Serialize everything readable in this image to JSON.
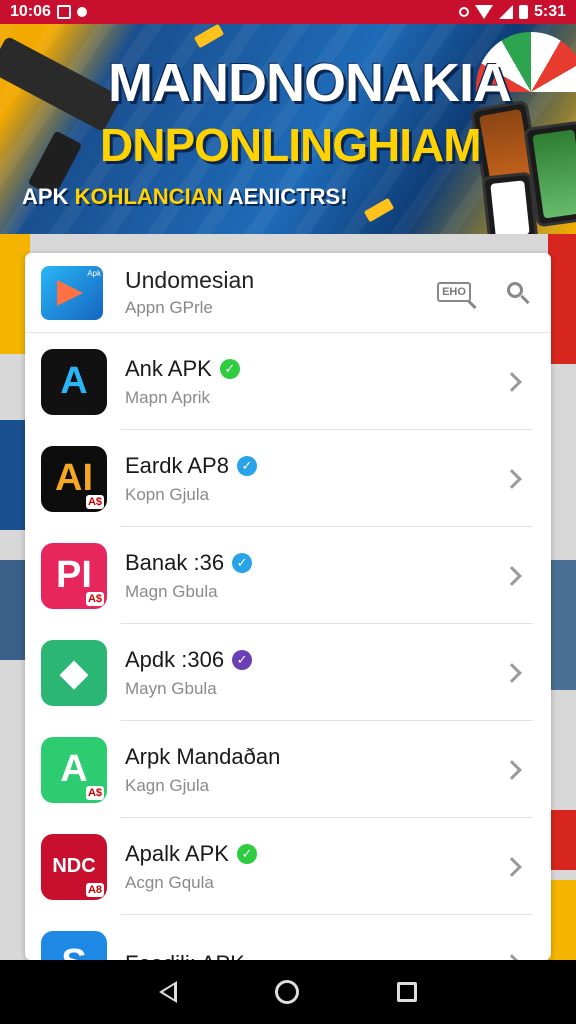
{
  "status_bar": {
    "time_left": "10:06",
    "time_right": "5:31"
  },
  "banner": {
    "title_line1": "MANDNONAKIA",
    "title_line2": "DNPONLINGHIAM",
    "subtitle_prefix": "APK",
    "subtitle_accent": "KOHLANCIAN",
    "subtitle_suffix": "AENICTRS!"
  },
  "header": {
    "title": "Undomesian",
    "subtitle": "Appn GPrle",
    "badge_text": "EHO",
    "logo_tag": "Apk"
  },
  "apps": [
    {
      "title": "Ank APK",
      "subtitle": "Mapn Aprik",
      "verified_color": "#2ecc40",
      "verified_glyph": "✓",
      "icon_bg": "#111111",
      "icon_fg": "#29b6f6",
      "icon_glyph": "A",
      "icon_mini": ""
    },
    {
      "title": "Eardk AP8",
      "subtitle": "Kopn Gjula",
      "verified_color": "#29a3e8",
      "verified_glyph": "✓",
      "icon_bg": "#0d0d0d",
      "icon_fg": "#f5a623",
      "icon_glyph": "AI",
      "icon_mini": "A$"
    },
    {
      "title": "Banak :36",
      "subtitle": "Magn Gbula",
      "verified_color": "#29a3e8",
      "verified_glyph": "✓",
      "icon_bg": "#e8265e",
      "icon_fg": "#ffffff",
      "icon_glyph": "PI",
      "icon_mini": "A$"
    },
    {
      "title": "Apdk :306",
      "subtitle": "Mayn Gbula",
      "verified_color": "#6a3fb5",
      "verified_glyph": "✓",
      "icon_bg": "#2bb673",
      "icon_fg": "#ffffff",
      "icon_glyph": "◆",
      "icon_mini": ""
    },
    {
      "title": "Arpk Mandaðan",
      "subtitle": "Kagn Gjula",
      "verified_color": "",
      "verified_glyph": "",
      "icon_bg": "#2ecc71",
      "icon_fg": "#ffffff",
      "icon_glyph": "A",
      "icon_mini": "A$"
    },
    {
      "title": "Apalk APK",
      "subtitle": "Acgn Gqula",
      "verified_color": "#2ecc40",
      "verified_glyph": "✓",
      "icon_bg": "#c8102e",
      "icon_fg": "#ffffff",
      "icon_glyph": "NDC",
      "icon_mini": "A8"
    },
    {
      "title": "Foadili: APK",
      "subtitle": "",
      "verified_color": "",
      "verified_glyph": "",
      "icon_bg": "#1e88e5",
      "icon_fg": "#ffffff",
      "icon_glyph": "S",
      "icon_mini": ""
    }
  ],
  "colors": {
    "status_bar": "#c8102e",
    "accent_yellow": "#ffd200",
    "banner_blue": "#1e6bb8"
  },
  "icons": [
    "alarm-icon",
    "wifi-icon",
    "signal-icon",
    "battery-icon",
    "badge-icon",
    "search-icon",
    "chevron-right-icon",
    "verified-icon",
    "back-icon",
    "home-icon",
    "recents-icon"
  ]
}
